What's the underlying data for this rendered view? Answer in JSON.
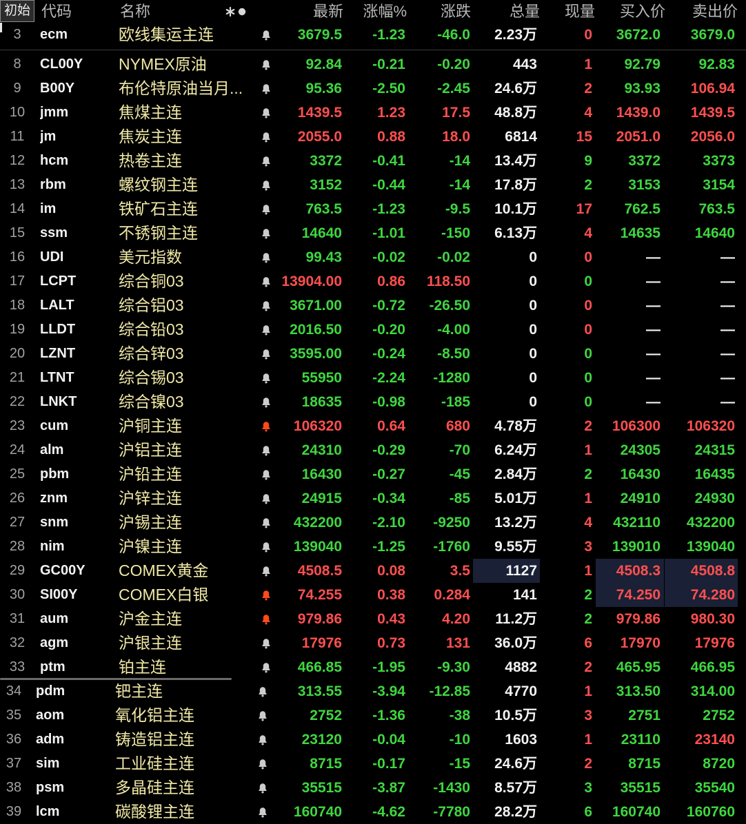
{
  "colors": {
    "background": "#000000",
    "up": "#ff4f4f",
    "down": "#3fd63f",
    "flat": "#f2f2f2",
    "row_number": "#a3a3a3",
    "code": "#f2f2f2",
    "name": "#f0e9a6",
    "header_text": "#b8b8b8",
    "flash_bg": "#1a2035",
    "bell": "#cccccc",
    "bell_alert": "#ff4a1a"
  },
  "icons": {
    "alert": "bell-icon",
    "header": [
      "asterisk-icon",
      "dot-icon"
    ]
  },
  "header": {
    "preset_button": "初始",
    "code": "代码",
    "name": "名称",
    "last": "最新",
    "pct": "涨幅%",
    "chg": "涨跌",
    "vol": "总量",
    "cur": "现量",
    "bid": "买入价",
    "ask": "卖出价"
  },
  "pinned_row": {
    "num": "3",
    "code": "ecm",
    "name": "欧线集运主连",
    "alert": false,
    "last": "3679.5",
    "pct": "-1.23",
    "chg": "-46.0",
    "vol": "2.23万",
    "cur": "0",
    "bid": "3672.0",
    "ask": "3679.0",
    "trend": "down",
    "cur_tone": "up",
    "bid_tone": "down",
    "ask_tone": "down"
  },
  "rows": [
    {
      "num": "8",
      "code": "CL00Y",
      "name": "NYMEX原油",
      "alert": false,
      "last": "92.84",
      "pct": "-0.21",
      "chg": "-0.20",
      "vol": "443",
      "cur": "1",
      "bid": "92.79",
      "ask": "92.83",
      "trend": "down",
      "cur_tone": "up",
      "bid_tone": "down",
      "ask_tone": "down"
    },
    {
      "num": "9",
      "code": "B00Y",
      "name": "布伦特原油当月...",
      "alert": false,
      "last": "95.36",
      "pct": "-2.50",
      "chg": "-2.45",
      "vol": "24.6万",
      "cur": "2",
      "bid": "93.93",
      "ask": "106.94",
      "trend": "down",
      "cur_tone": "up",
      "bid_tone": "down",
      "ask_tone": "up"
    },
    {
      "num": "10",
      "code": "jmm",
      "name": "焦煤主连",
      "alert": false,
      "last": "1439.5",
      "pct": "1.23",
      "chg": "17.5",
      "vol": "48.8万",
      "cur": "4",
      "bid": "1439.0",
      "ask": "1439.5",
      "trend": "up",
      "cur_tone": "up",
      "bid_tone": "up",
      "ask_tone": "up"
    },
    {
      "num": "11",
      "code": "jm",
      "name": "焦炭主连",
      "alert": false,
      "last": "2055.0",
      "pct": "0.88",
      "chg": "18.0",
      "vol": "6814",
      "cur": "15",
      "bid": "2051.0",
      "ask": "2056.0",
      "trend": "up",
      "cur_tone": "up",
      "bid_tone": "up",
      "ask_tone": "up"
    },
    {
      "num": "12",
      "code": "hcm",
      "name": "热卷主连",
      "alert": false,
      "last": "3372",
      "pct": "-0.41",
      "chg": "-14",
      "vol": "13.4万",
      "cur": "9",
      "bid": "3372",
      "ask": "3373",
      "trend": "down",
      "cur_tone": "down",
      "bid_tone": "down",
      "ask_tone": "down"
    },
    {
      "num": "13",
      "code": "rbm",
      "name": "螺纹钢主连",
      "alert": false,
      "last": "3152",
      "pct": "-0.44",
      "chg": "-14",
      "vol": "17.8万",
      "cur": "2",
      "bid": "3153",
      "ask": "3154",
      "trend": "down",
      "cur_tone": "down",
      "bid_tone": "down",
      "ask_tone": "down"
    },
    {
      "num": "14",
      "code": "im",
      "name": "铁矿石主连",
      "alert": false,
      "last": "763.5",
      "pct": "-1.23",
      "chg": "-9.5",
      "vol": "10.1万",
      "cur": "17",
      "bid": "762.5",
      "ask": "763.5",
      "trend": "down",
      "cur_tone": "up",
      "bid_tone": "down",
      "ask_tone": "down"
    },
    {
      "num": "15",
      "code": "ssm",
      "name": "不锈钢主连",
      "alert": false,
      "last": "14640",
      "pct": "-1.01",
      "chg": "-150",
      "vol": "6.13万",
      "cur": "4",
      "bid": "14635",
      "ask": "14640",
      "trend": "down",
      "cur_tone": "up",
      "bid_tone": "down",
      "ask_tone": "down"
    },
    {
      "num": "16",
      "code": "UDI",
      "name": "美元指数",
      "alert": false,
      "last": "99.43",
      "pct": "-0.02",
      "chg": "-0.02",
      "vol": "0",
      "cur": "0",
      "bid": "—",
      "ask": "—",
      "trend": "down",
      "cur_tone": "up",
      "bid_tone": "flat",
      "ask_tone": "flat"
    },
    {
      "num": "17",
      "code": "LCPT",
      "name": "综合铜03",
      "alert": false,
      "last": "13904.00",
      "pct": "0.86",
      "chg": "118.50",
      "vol": "0",
      "cur": "0",
      "bid": "—",
      "ask": "—",
      "trend": "up",
      "cur_tone": "down",
      "bid_tone": "flat",
      "ask_tone": "flat"
    },
    {
      "num": "18",
      "code": "LALT",
      "name": "综合铝03",
      "alert": false,
      "last": "3671.00",
      "pct": "-0.72",
      "chg": "-26.50",
      "vol": "0",
      "cur": "0",
      "bid": "—",
      "ask": "—",
      "trend": "down",
      "cur_tone": "up",
      "bid_tone": "flat",
      "ask_tone": "flat"
    },
    {
      "num": "19",
      "code": "LLDT",
      "name": "综合铅03",
      "alert": false,
      "last": "2016.50",
      "pct": "-0.20",
      "chg": "-4.00",
      "vol": "0",
      "cur": "0",
      "bid": "—",
      "ask": "—",
      "trend": "down",
      "cur_tone": "up",
      "bid_tone": "flat",
      "ask_tone": "flat"
    },
    {
      "num": "20",
      "code": "LZNT",
      "name": "综合锌03",
      "alert": false,
      "last": "3595.00",
      "pct": "-0.24",
      "chg": "-8.50",
      "vol": "0",
      "cur": "0",
      "bid": "—",
      "ask": "—",
      "trend": "down",
      "cur_tone": "down",
      "bid_tone": "flat",
      "ask_tone": "flat"
    },
    {
      "num": "21",
      "code": "LTNT",
      "name": "综合锡03",
      "alert": false,
      "last": "55950",
      "pct": "-2.24",
      "chg": "-1280",
      "vol": "0",
      "cur": "0",
      "bid": "—",
      "ask": "—",
      "trend": "down",
      "cur_tone": "down",
      "bid_tone": "flat",
      "ask_tone": "flat"
    },
    {
      "num": "22",
      "code": "LNKT",
      "name": "综合镍03",
      "alert": false,
      "last": "18635",
      "pct": "-0.98",
      "chg": "-185",
      "vol": "0",
      "cur": "0",
      "bid": "—",
      "ask": "—",
      "trend": "down",
      "cur_tone": "down",
      "bid_tone": "flat",
      "ask_tone": "flat"
    },
    {
      "num": "23",
      "code": "cum",
      "name": "沪铜主连",
      "alert": true,
      "last": "106320",
      "pct": "0.64",
      "chg": "680",
      "vol": "4.78万",
      "cur": "2",
      "bid": "106300",
      "ask": "106320",
      "trend": "up",
      "cur_tone": "up",
      "bid_tone": "up",
      "ask_tone": "up"
    },
    {
      "num": "24",
      "code": "alm",
      "name": "沪铝主连",
      "alert": false,
      "last": "24310",
      "pct": "-0.29",
      "chg": "-70",
      "vol": "6.24万",
      "cur": "1",
      "bid": "24305",
      "ask": "24315",
      "trend": "down",
      "cur_tone": "up",
      "bid_tone": "down",
      "ask_tone": "down"
    },
    {
      "num": "25",
      "code": "pbm",
      "name": "沪铅主连",
      "alert": false,
      "last": "16430",
      "pct": "-0.27",
      "chg": "-45",
      "vol": "2.84万",
      "cur": "2",
      "bid": "16430",
      "ask": "16435",
      "trend": "down",
      "cur_tone": "down",
      "bid_tone": "down",
      "ask_tone": "down"
    },
    {
      "num": "26",
      "code": "znm",
      "name": "沪锌主连",
      "alert": false,
      "last": "24915",
      "pct": "-0.34",
      "chg": "-85",
      "vol": "5.01万",
      "cur": "1",
      "bid": "24910",
      "ask": "24930",
      "trend": "down",
      "cur_tone": "up",
      "bid_tone": "down",
      "ask_tone": "down"
    },
    {
      "num": "27",
      "code": "snm",
      "name": "沪锡主连",
      "alert": false,
      "last": "432200",
      "pct": "-2.10",
      "chg": "-9250",
      "vol": "13.2万",
      "cur": "4",
      "bid": "432110",
      "ask": "432200",
      "trend": "down",
      "cur_tone": "up",
      "bid_tone": "down",
      "ask_tone": "down"
    },
    {
      "num": "28",
      "code": "nim",
      "name": "沪镍主连",
      "alert": false,
      "last": "139040",
      "pct": "-1.25",
      "chg": "-1760",
      "vol": "9.55万",
      "cur": "3",
      "bid": "139010",
      "ask": "139040",
      "trend": "down",
      "cur_tone": "up",
      "bid_tone": "down",
      "ask_tone": "down"
    },
    {
      "num": "29",
      "code": "GC00Y",
      "name": "COMEX黄金",
      "alert": false,
      "last": "4508.5",
      "pct": "0.08",
      "chg": "3.5",
      "vol": "1127",
      "cur": "1",
      "bid": "4508.3",
      "ask": "4508.8",
      "trend": "up",
      "cur_tone": "up",
      "bid_tone": "up",
      "ask_tone": "up",
      "flash": [
        "vol",
        "bid",
        "ask"
      ]
    },
    {
      "num": "30",
      "code": "SI00Y",
      "name": "COMEX白银",
      "alert": true,
      "last": "74.255",
      "pct": "0.38",
      "chg": "0.284",
      "vol": "141",
      "cur": "2",
      "bid": "74.250",
      "ask": "74.280",
      "trend": "up",
      "cur_tone": "down",
      "bid_tone": "up",
      "ask_tone": "up",
      "flash": [
        "bid",
        "ask"
      ]
    },
    {
      "num": "31",
      "code": "aum",
      "name": "沪金主连",
      "alert": true,
      "last": "979.86",
      "pct": "0.43",
      "chg": "4.20",
      "vol": "11.2万",
      "cur": "2",
      "bid": "979.86",
      "ask": "980.30",
      "trend": "up",
      "cur_tone": "down",
      "bid_tone": "up",
      "ask_tone": "up"
    },
    {
      "num": "32",
      "code": "agm",
      "name": "沪银主连",
      "alert": false,
      "last": "17976",
      "pct": "0.73",
      "chg": "131",
      "vol": "36.0万",
      "cur": "6",
      "bid": "17970",
      "ask": "17976",
      "trend": "up",
      "cur_tone": "up",
      "bid_tone": "up",
      "ask_tone": "up"
    },
    {
      "num": "33",
      "code": "ptm",
      "name": "铂主连",
      "alert": false,
      "last": "466.85",
      "pct": "-1.95",
      "chg": "-9.30",
      "vol": "4882",
      "cur": "2",
      "bid": "465.95",
      "ask": "466.95",
      "trend": "down",
      "cur_tone": "up",
      "bid_tone": "down",
      "ask_tone": "down"
    },
    {
      "num": "34",
      "code": "pdm",
      "name": "钯主连",
      "alert": false,
      "last": "313.55",
      "pct": "-3.94",
      "chg": "-12.85",
      "vol": "4770",
      "cur": "1",
      "bid": "313.50",
      "ask": "314.00",
      "trend": "down",
      "cur_tone": "up",
      "bid_tone": "down",
      "ask_tone": "down"
    },
    {
      "num": "35",
      "code": "aom",
      "name": "氧化铝主连",
      "alert": false,
      "last": "2752",
      "pct": "-1.36",
      "chg": "-38",
      "vol": "10.5万",
      "cur": "3",
      "bid": "2751",
      "ask": "2752",
      "trend": "down",
      "cur_tone": "up",
      "bid_tone": "down",
      "ask_tone": "down"
    },
    {
      "num": "36",
      "code": "adm",
      "name": "铸造铝主连",
      "alert": false,
      "last": "23120",
      "pct": "-0.04",
      "chg": "-10",
      "vol": "1603",
      "cur": "1",
      "bid": "23110",
      "ask": "23140",
      "trend": "down",
      "cur_tone": "up",
      "bid_tone": "down",
      "ask_tone": "up"
    },
    {
      "num": "37",
      "code": "sim",
      "name": "工业硅主连",
      "alert": false,
      "last": "8715",
      "pct": "-0.17",
      "chg": "-15",
      "vol": "24.6万",
      "cur": "2",
      "bid": "8715",
      "ask": "8720",
      "trend": "down",
      "cur_tone": "up",
      "bid_tone": "down",
      "ask_tone": "down"
    },
    {
      "num": "38",
      "code": "psm",
      "name": "多晶硅主连",
      "alert": false,
      "last": "35515",
      "pct": "-3.87",
      "chg": "-1430",
      "vol": "8.57万",
      "cur": "3",
      "bid": "35515",
      "ask": "35540",
      "trend": "down",
      "cur_tone": "down",
      "bid_tone": "down",
      "ask_tone": "down"
    },
    {
      "num": "39",
      "code": "lcm",
      "name": "碳酸锂主连",
      "alert": false,
      "last": "160740",
      "pct": "-4.62",
      "chg": "-7780",
      "vol": "28.2万",
      "cur": "6",
      "bid": "160740",
      "ask": "160760",
      "trend": "down",
      "cur_tone": "down",
      "bid_tone": "down",
      "ask_tone": "down"
    }
  ]
}
